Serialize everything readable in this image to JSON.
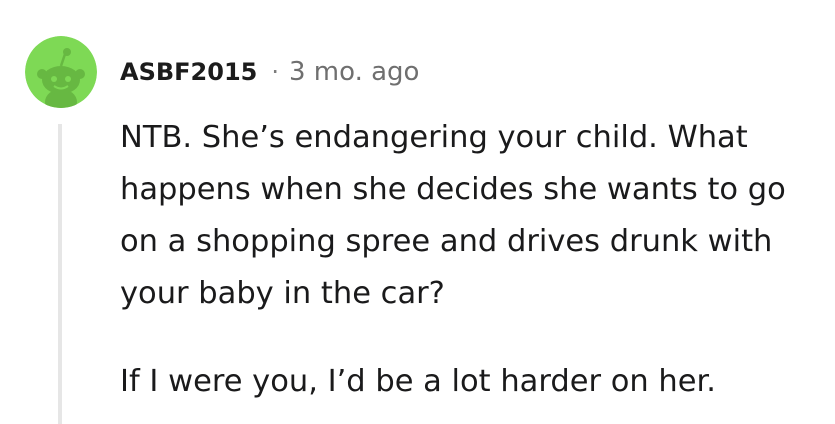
{
  "comment": {
    "avatar_icon": "reddit-snoo-green-avatar",
    "avatar_color": "#7ed955",
    "username": "ASBF2015",
    "separator": "·",
    "timestamp": "3 mo. ago",
    "body": {
      "paragraph_1": "NTB. She’s endangering your child. What happens when she decides she wants to go on a shopping spree and drives drunk with your baby in the car?",
      "paragraph_2": "If I were you, I’d be a lot harder on her."
    }
  }
}
